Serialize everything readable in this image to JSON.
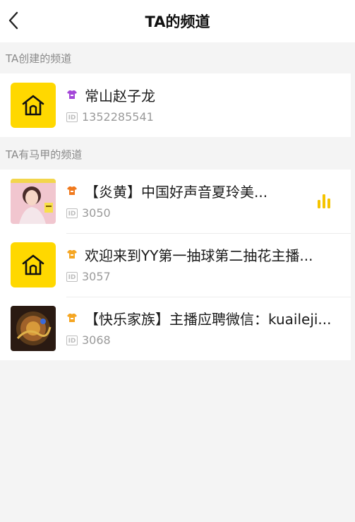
{
  "header": {
    "title": "TA的频道"
  },
  "created_section": {
    "label": "TA创建的频道",
    "items": [
      {
        "name": "常山赵子龙",
        "id": "1352285541",
        "avatar": "house",
        "badge_color": "#a447d8"
      }
    ]
  },
  "vest_section": {
    "label": "TA有马甲的频道",
    "items": [
      {
        "name": "【炎黄】中国好声音夏玲美...",
        "id": "3050",
        "avatar": "photo-girl",
        "badge_color": "#f07a1e",
        "live": true
      },
      {
        "name": "欢迎来到YY第一抽球第二抽花主播...",
        "id": "3057",
        "avatar": "house",
        "badge_color": "#f5a623"
      },
      {
        "name": "【快乐家族】主播应聘微信：kuaileji...",
        "id": "3068",
        "avatar": "dragon-emblem",
        "badge_color": "#f5a623"
      }
    ]
  },
  "colors": {
    "accent_yellow": "#ffd800",
    "live_icon": "#f5c400"
  },
  "icons": {
    "back": "chevron-left-icon",
    "id": "id-icon",
    "badge": "shirt-badge-icon",
    "live": "live-bars-icon",
    "house": "house-icon"
  },
  "id_icon_text": "ID"
}
